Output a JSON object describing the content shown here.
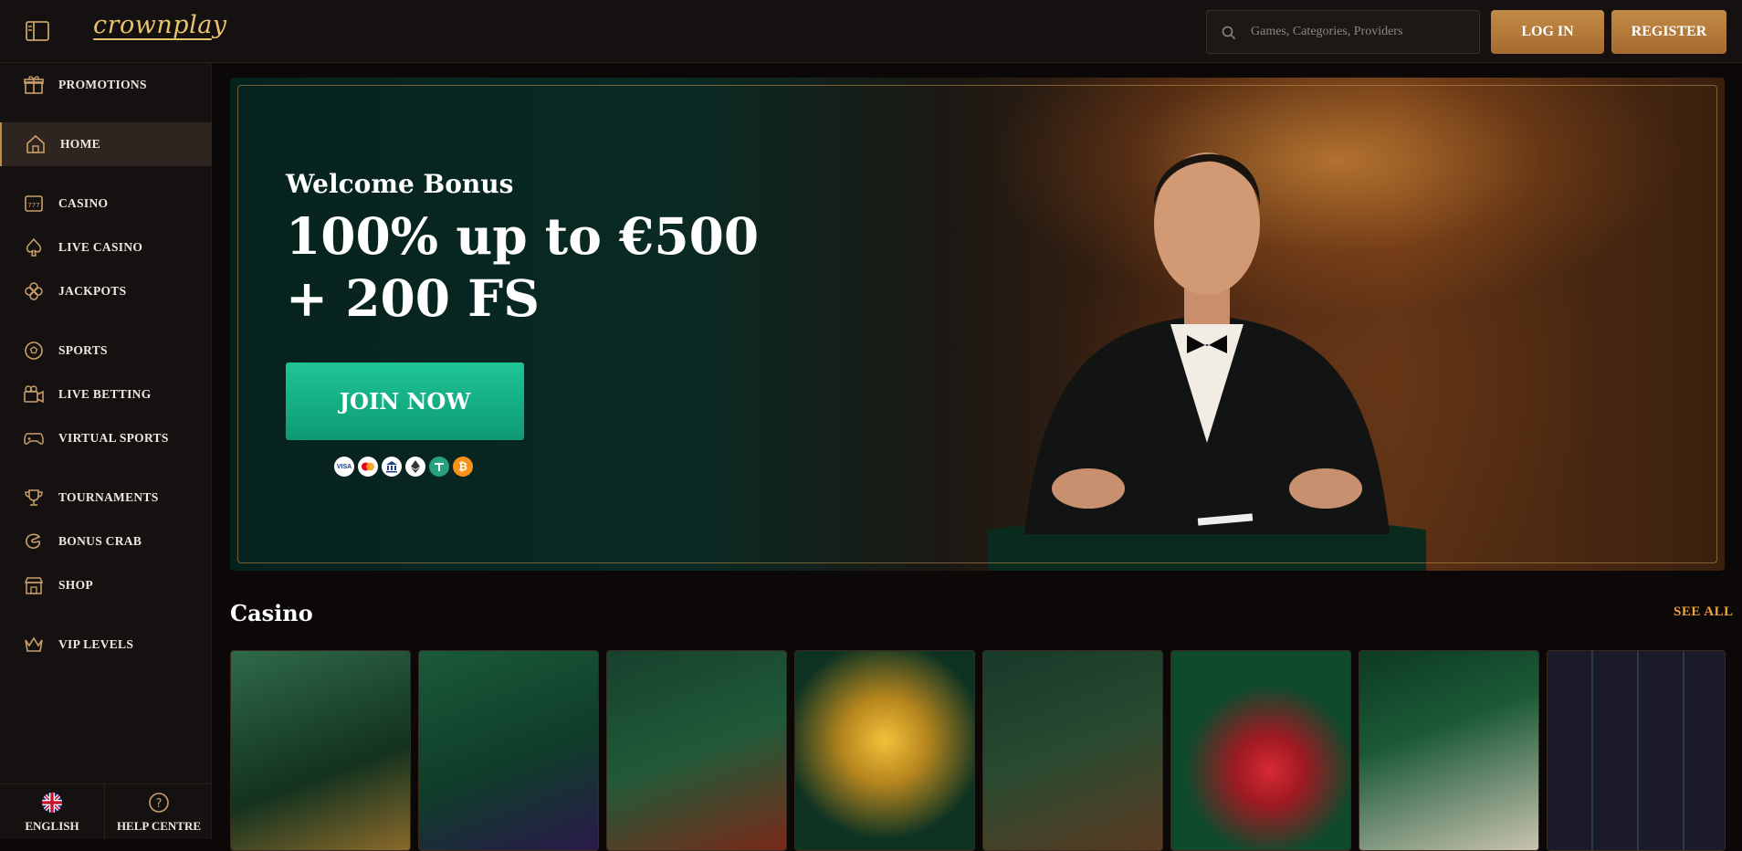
{
  "header": {
    "logo_text": "crownplay",
    "search_placeholder": "Games, Categories, Providers",
    "login_label": "LOG IN",
    "register_label": "REGISTER"
  },
  "sidebar": {
    "items": [
      {
        "label": "PROMOTIONS",
        "icon": "gift-icon"
      },
      {
        "label": "HOME",
        "icon": "home-icon",
        "active": true
      },
      {
        "label": "CASINO",
        "icon": "slot-machine-icon"
      },
      {
        "label": "LIVE CASINO",
        "icon": "spade-icon"
      },
      {
        "label": "JACKPOTS",
        "icon": "clover-icon"
      },
      {
        "label": "SPORTS",
        "icon": "soccer-ball-icon"
      },
      {
        "label": "LIVE BETTING",
        "icon": "video-camera-icon"
      },
      {
        "label": "VIRTUAL SPORTS",
        "icon": "gamepad-icon"
      },
      {
        "label": "TOURNAMENTS",
        "icon": "trophy-icon"
      },
      {
        "label": "BONUS CRAB",
        "icon": "crab-claw-icon"
      },
      {
        "label": "SHOP",
        "icon": "shop-icon"
      },
      {
        "label": "VIP LEVELS",
        "icon": "crown-icon"
      }
    ],
    "language_label": "ENGLISH",
    "help_label": "HELP CENTRE"
  },
  "hero": {
    "subtitle": "Welcome Bonus",
    "headline_line1": "100% up to €500",
    "headline_line2": "+ 200 FS",
    "cta_label": "JOIN NOW",
    "payment_icons": [
      "visa-icon",
      "mastercard-icon",
      "bank-icon",
      "ethereum-icon",
      "tether-icon",
      "bitcoin-icon"
    ],
    "payment_labels": [
      "VISA",
      "",
      "",
      "",
      "",
      "₿"
    ]
  },
  "casino_section": {
    "title": "Casino",
    "see_all_label": "SEE ALL",
    "tiles": [
      {
        "theme": "viking-couple-game-tile",
        "colors": [
          "#2f6a4a",
          "#8a6a2a"
        ]
      },
      {
        "theme": "skeleton-magician-game-tile",
        "colors": [
          "#0f3d2a",
          "#2a1a4a"
        ]
      },
      {
        "theme": "gnome-and-lady-game-tile",
        "colors": [
          "#17412e",
          "#7a2a1a"
        ]
      },
      {
        "theme": "golden-diamond-game-tile",
        "colors": [
          "#0e3322",
          "#b7861e"
        ]
      },
      {
        "theme": "dealer-couple-game-tile",
        "colors": [
          "#173a2a",
          "#5a3a22"
        ]
      },
      {
        "theme": "fruit-cherries-game-tile",
        "colors": [
          "#0f4a2c",
          "#a01a22"
        ]
      },
      {
        "theme": "cards-and-chips-game-tile",
        "colors": [
          "#0d3a24",
          "#c9c3b2"
        ]
      },
      {
        "theme": "slot-reels-game-tile",
        "colors": [
          "#1a1a2a",
          "#3a5a2a"
        ]
      }
    ]
  },
  "colors": {
    "accent_gold": "#c28a47",
    "cta_green": "#14b383",
    "see_all_orange": "#f0a23a"
  }
}
